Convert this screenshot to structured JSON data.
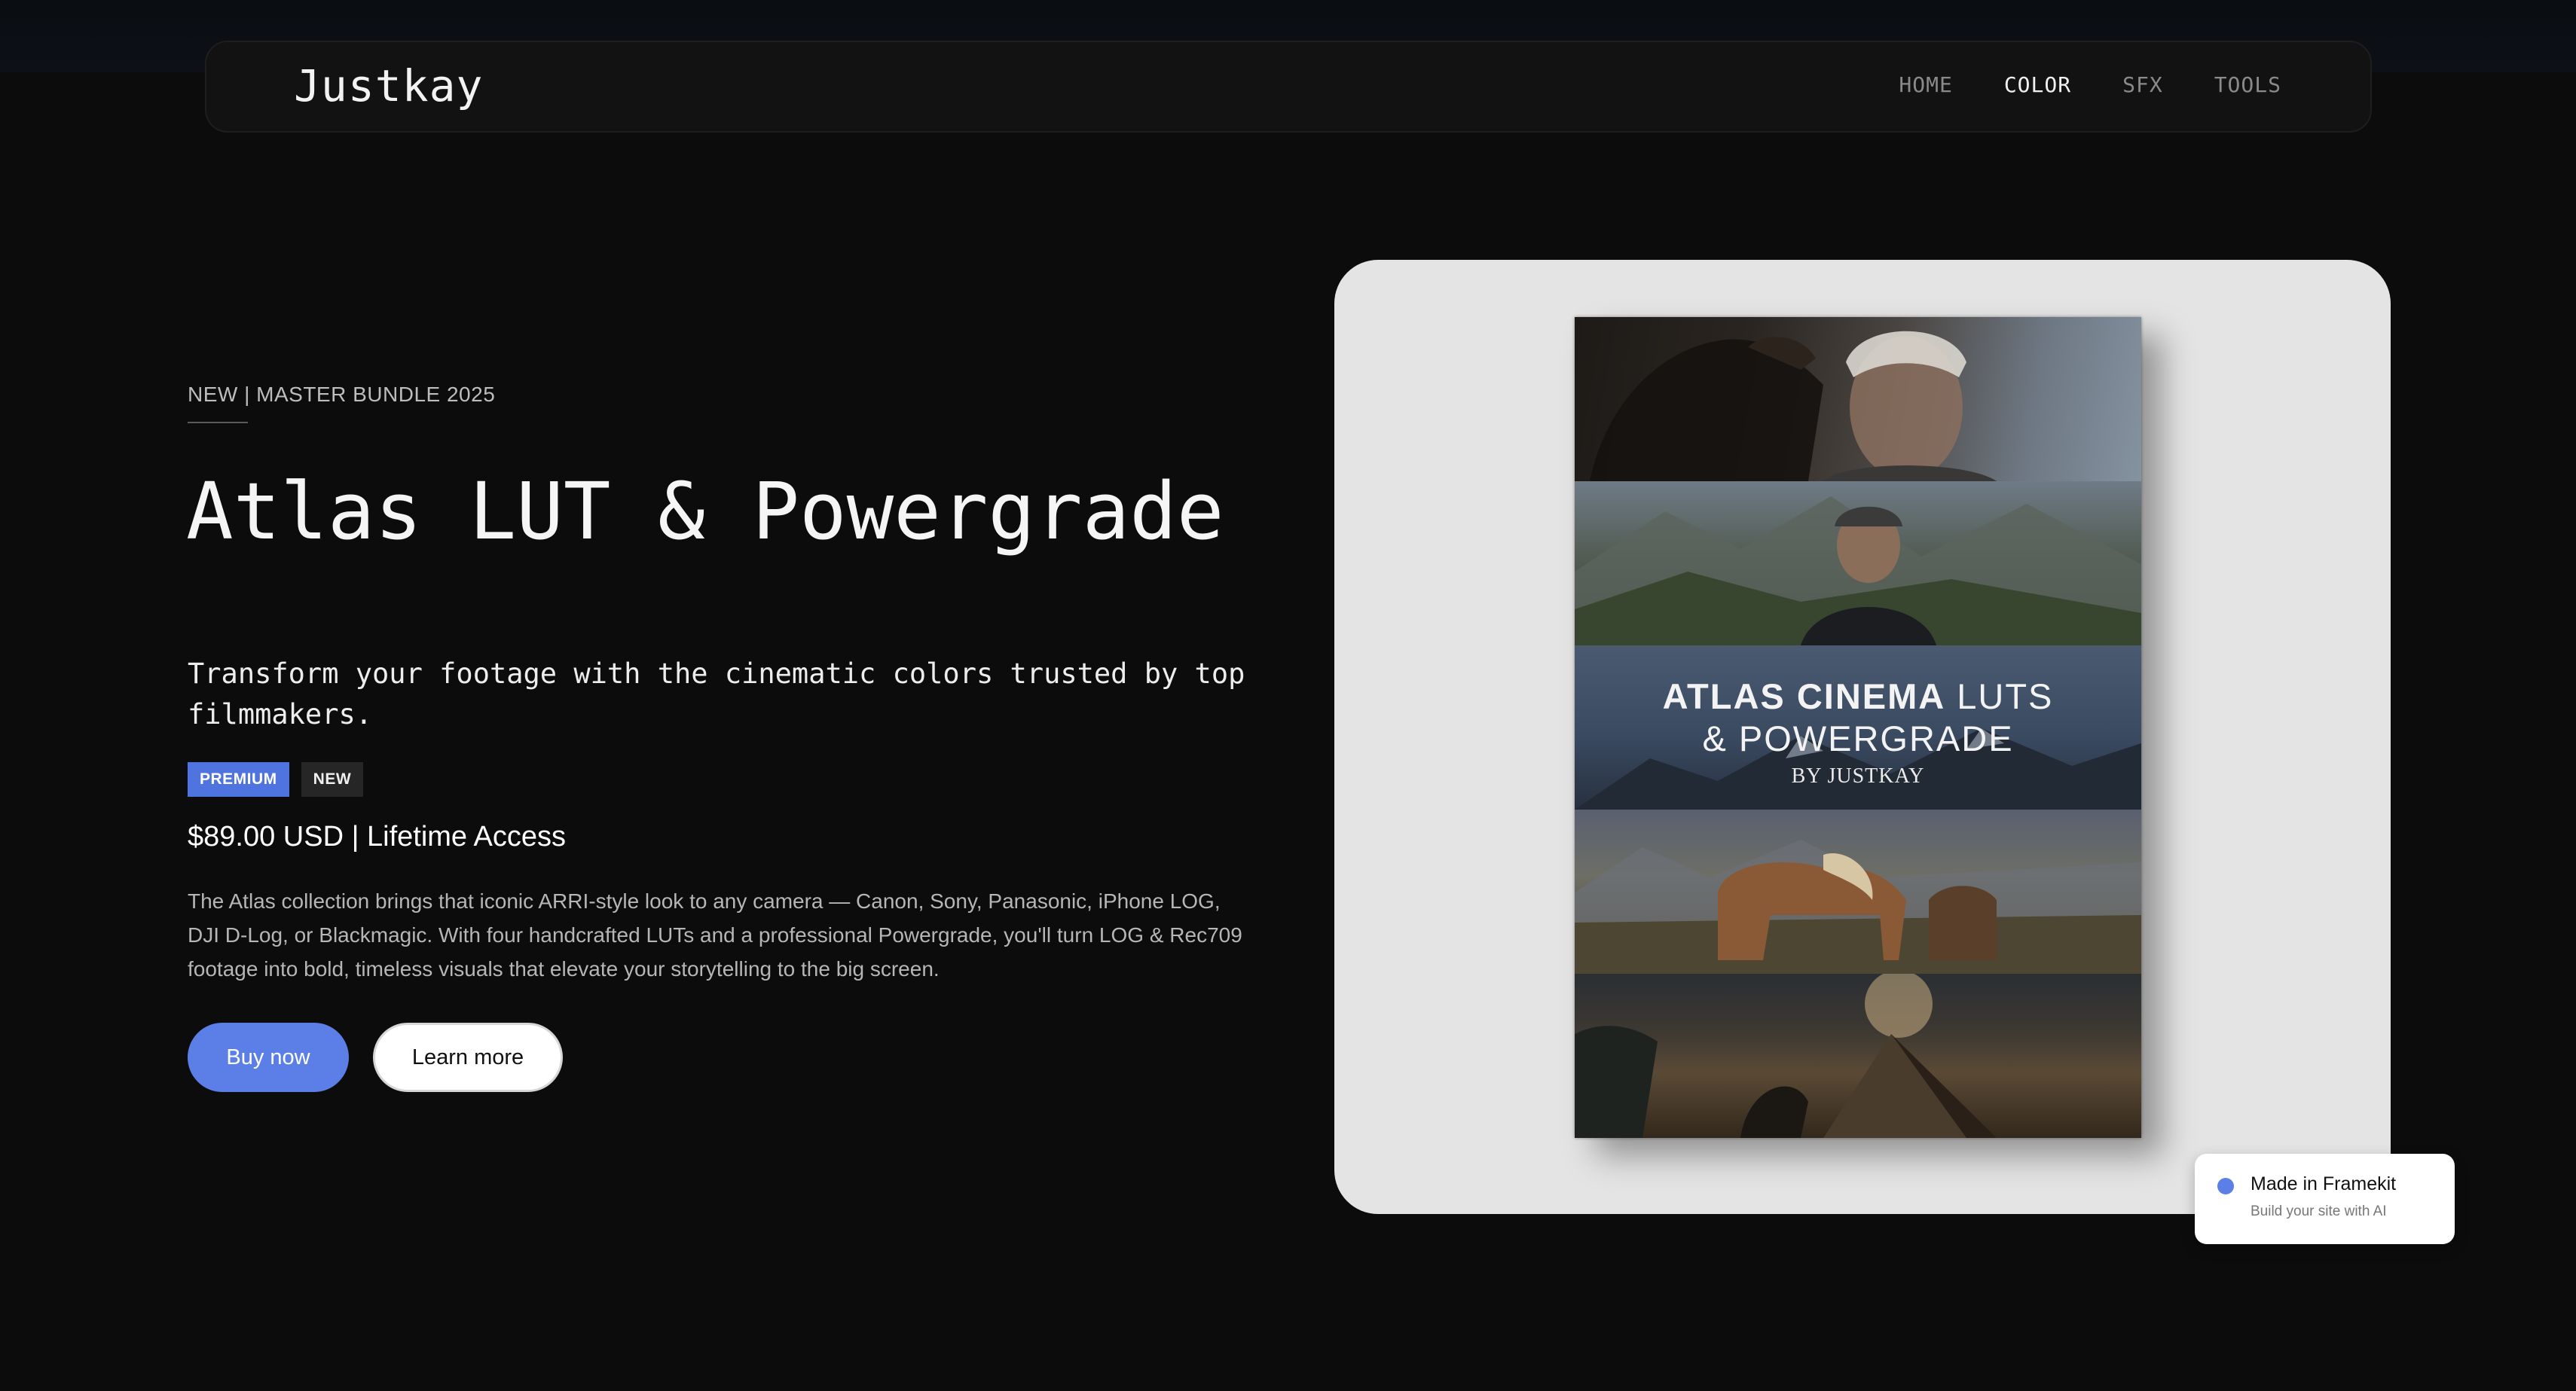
{
  "brand": {
    "logo": "Justkay"
  },
  "nav": {
    "items": [
      {
        "label": "HOME",
        "active": false
      },
      {
        "label": "COLOR",
        "active": true
      },
      {
        "label": "SFX",
        "active": false
      },
      {
        "label": "TOOLS",
        "active": false
      }
    ]
  },
  "hero": {
    "eyebrow": "NEW | MASTER BUNDLE 2025",
    "title": "Atlas LUT & Powergrade",
    "subtitle": "Transform your footage with the cinematic colors trusted by top filmmakers.",
    "badges": [
      "PREMIUM",
      "NEW"
    ],
    "price": "$89.00 USD | Lifetime Access",
    "description": "The Atlas collection brings that iconic ARRI-style look to any camera — Canon, Sony, Panasonic, iPhone LOG, DJI D-Log, or Blackmagic. With four handcrafted LUTs and a professional Powergrade, you'll turn LOG & Rec709 footage into bold, timeless visuals that elevate your storytelling to the big screen.",
    "buttons": {
      "primary": "Buy now",
      "secondary": "Learn more"
    }
  },
  "product_box": {
    "title_bold": "ATLAS CINEMA",
    "title_light_1": "LUTS",
    "title_light_2": "& POWERGRADE",
    "byline": "BY JUSTKAY"
  },
  "framekit_badge": {
    "title": "Made in Framekit",
    "subtitle": "Build your site with AI"
  },
  "colors": {
    "accent": "#5b7fe6",
    "background": "#0c0c0c",
    "card": "#e4e4e4"
  }
}
